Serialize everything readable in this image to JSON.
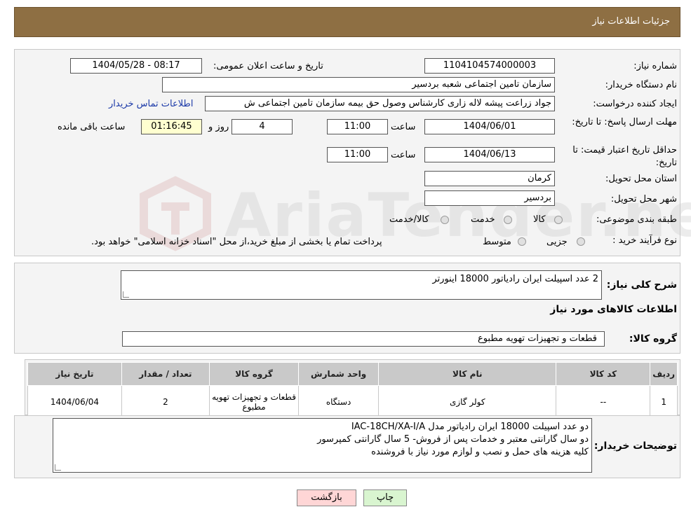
{
  "header": {
    "title": "جزئیات اطلاعات نیاز"
  },
  "form": {
    "need_number_label": "شماره نیاز:",
    "need_number": "1104104574000003",
    "announce_label": "تاریخ و ساعت اعلان عمومی:",
    "announce_value": "1404/05/28 - 08:17",
    "buyer_org_label": "نام دستگاه خریدار:",
    "buyer_org": "سازمان تامین اجتماعی شعبه بردسیر",
    "requester_label": "ایجاد کننده درخواست:",
    "requester": "جواد زراعت پیشه لاله زاری کارشناس وصول حق بیمه سازمان تامین اجتماعی ش",
    "contact_link": "اطلاعات تماس خریدار",
    "reply_deadline_label": "مهلت ارسال پاسخ: تا تاریخ:",
    "reply_date": "1404/06/01",
    "time_label": "ساعت",
    "reply_time": "11:00",
    "days": "4",
    "days_label": "روز و",
    "remaining_time": "01:16:45",
    "remaining_label": "ساعت باقی مانده",
    "validity_label": "حداقل تاریخ اعتبار قیمت: تا تاریخ:",
    "validity_date": "1404/06/13",
    "validity_time": "11:00",
    "province_label": "استان محل تحویل:",
    "province": "کرمان",
    "city_label": "شهر محل تحویل:",
    "city": "بردسیر",
    "category_label": "طبقه بندی موضوعی:",
    "category_options": [
      "کالا",
      "خدمت",
      "کالا/خدمت"
    ],
    "purchase_type_label": "نوع فرآیند خرید :",
    "purchase_options": [
      "جزیی",
      "متوسط"
    ],
    "purchase_note": "پرداخت تمام یا بخشی از مبلغ خرید،از محل \"اسناد خزانه اسلامی\" خواهد بود."
  },
  "description": {
    "label": "شرح کلی نیاز:",
    "value": "2 عدد اسپیلت ایران رادیاتور 18000 اینورتر"
  },
  "goods": {
    "section_title": "اطلاعات کالاهای مورد نیاز",
    "group_label": "گروه کالا:",
    "group_value": "قطعات و تجهیزات تهویه مطبوع"
  },
  "table": {
    "headers": [
      "ردیف",
      "کد کالا",
      "نام کالا",
      "واحد شمارش",
      "گروه کالا",
      "تعداد / مقدار",
      "تاریخ نیاز"
    ],
    "rows": [
      {
        "row": "1",
        "code": "--",
        "name": "کولر گازی",
        "unit": "دستگاه",
        "group": "قطعات و تجهیزات تهویه مطبوع",
        "qty": "2",
        "date": "1404/06/04"
      }
    ]
  },
  "notes": {
    "label": "توضیحات خریدار:",
    "line1": "دو عدد اسپیلت 18000 ایران رادیاتور مدل IAC-18CH/XA-I/A",
    "line2": "دو سال گارانتی معتبر و خدمات پس از فروش- 5 سال گارانتی کمپرسور",
    "line3": "کلیه هزینه های حمل و نصب و لوازم مورد نیاز با فروشنده"
  },
  "buttons": {
    "print": "چاپ",
    "back": "بازگشت"
  },
  "colors": {
    "header_bg": "#8e6f43",
    "link": "#1c3aa8",
    "back_button": "#ffd6d6",
    "print_button": "#d9f5d0"
  }
}
